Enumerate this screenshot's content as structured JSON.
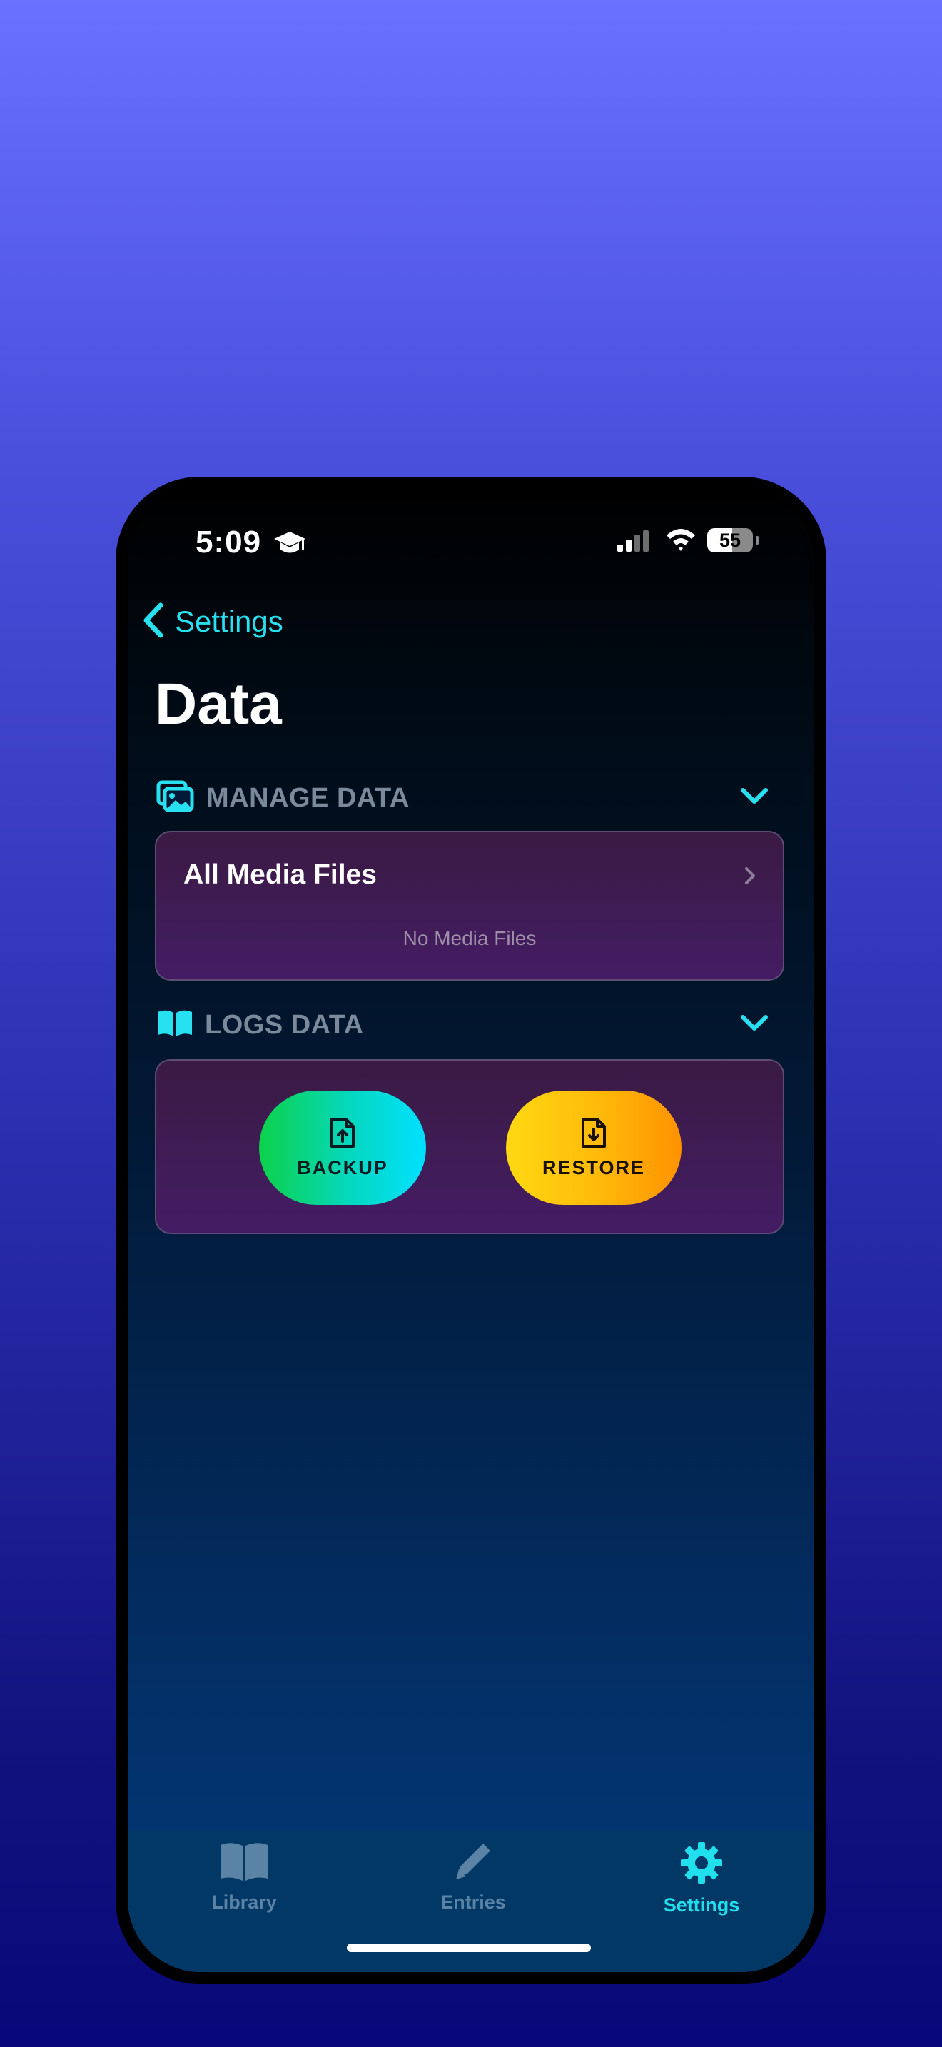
{
  "status": {
    "time": "5:09",
    "battery": "55"
  },
  "nav": {
    "back_label": "Settings"
  },
  "page": {
    "title": "Data"
  },
  "manage_section": {
    "title": "MANAGE DATA",
    "row_label": "All Media Files",
    "empty_text": "No Media Files"
  },
  "logs_section": {
    "title": "LOGS DATA",
    "backup_label": "BACKUP",
    "restore_label": "RESTORE"
  },
  "tabs": [
    {
      "label": "Library",
      "icon": "book-icon",
      "active": false
    },
    {
      "label": "Entries",
      "icon": "pencil-icon",
      "active": false
    },
    {
      "label": "Settings",
      "icon": "gear-icon",
      "active": true
    }
  ],
  "colors": {
    "accent": "#27e0f0",
    "card": "#441c64",
    "backup": "#00e0ff",
    "restore": "#ff9200"
  }
}
